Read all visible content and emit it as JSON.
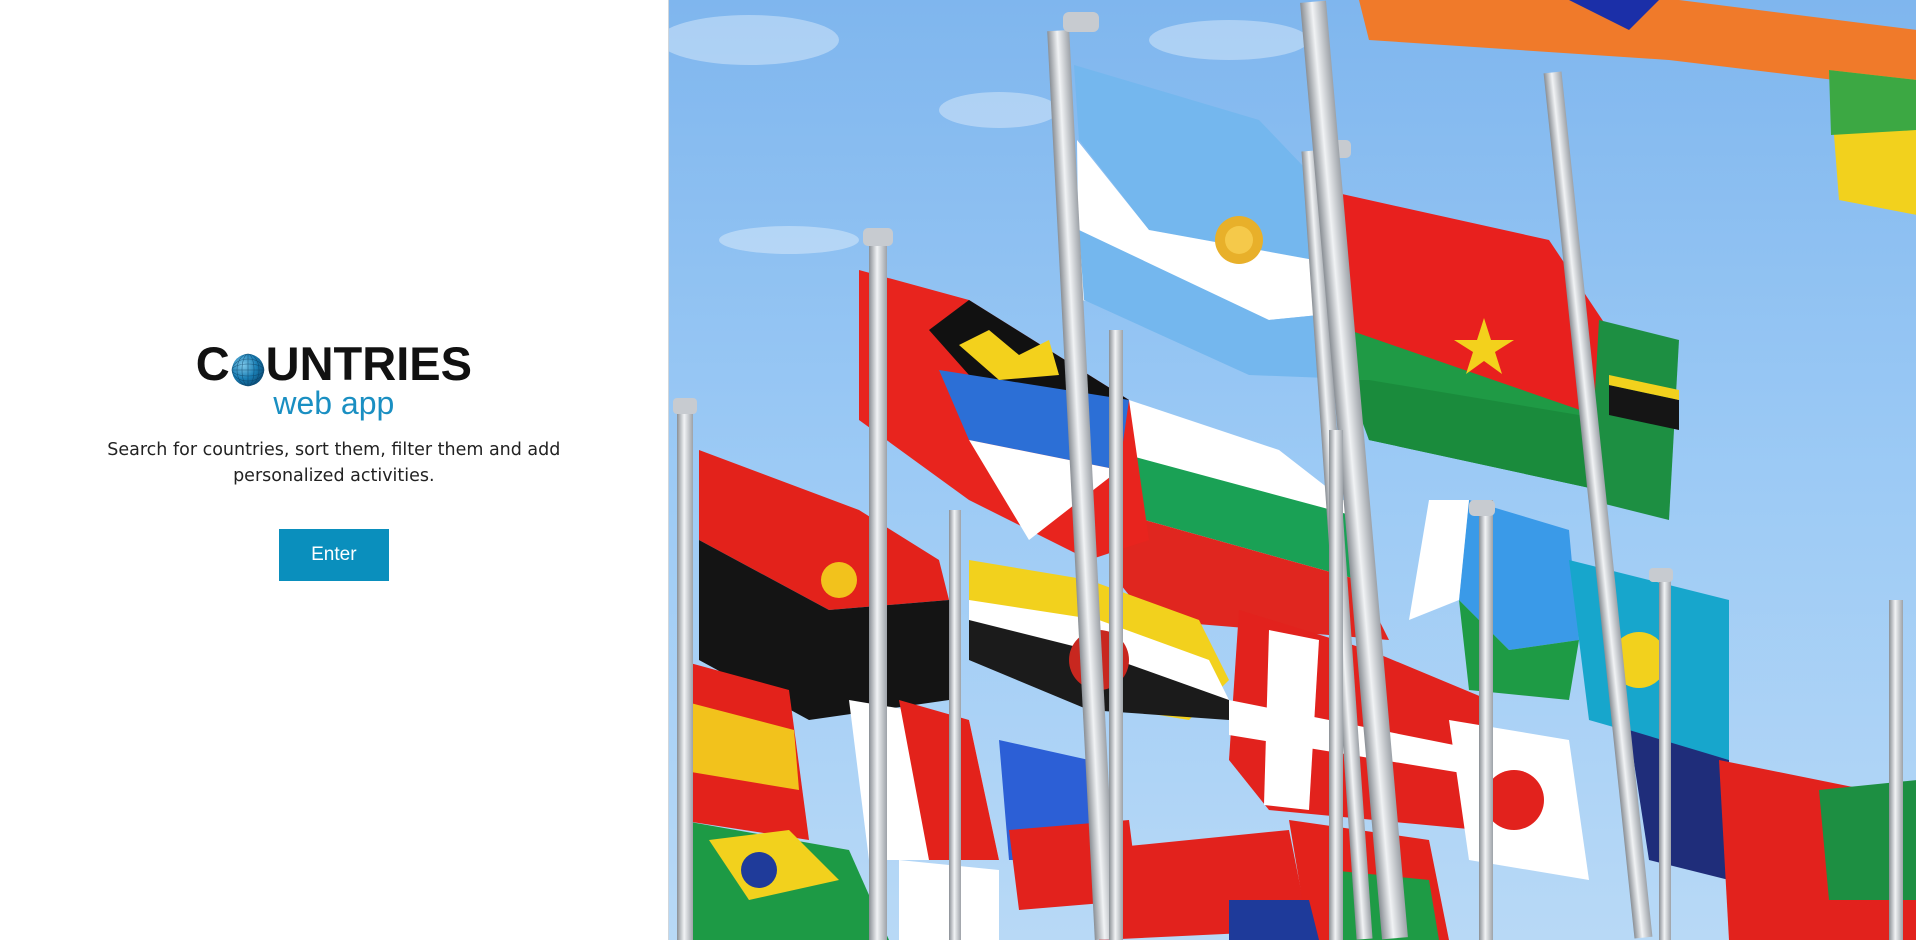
{
  "logo": {
    "word_start": "C",
    "word_end": "UNTRIES",
    "subtitle": "web app"
  },
  "hero": {
    "tagline": "Search for countries, sort them, filter them and add personalized activities.",
    "enter_label": "Enter"
  },
  "colors": {
    "accent": "#0a8fbd",
    "logo_subtitle": "#1a8fc2",
    "sky": "#8ec3f2"
  },
  "icons": {
    "logo_globe": "globe-icon"
  },
  "image": {
    "subject": "flags-photo"
  }
}
